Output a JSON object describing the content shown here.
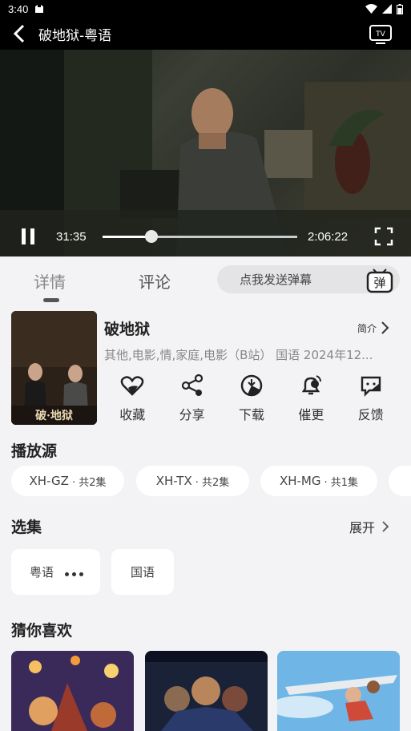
{
  "status_bar": {
    "time": "3:40"
  },
  "header": {
    "title": "破地狱-粤语",
    "back_icon": "back-arrow-icon",
    "cast_icon": "tv-cast-icon"
  },
  "player": {
    "current_time": "31:35",
    "total_time": "2:06:22",
    "progress": 0.25,
    "state": "playing"
  },
  "tabs": [
    {
      "label": "详情",
      "active": true
    },
    {
      "label": "评论",
      "active": false
    }
  ],
  "danmu": {
    "placeholder": "点我发送弹幕",
    "badge": "弹"
  },
  "movie": {
    "title": "破地狱",
    "intro_label": "简介",
    "meta": "其他,电影,情,家庭,电影（B站） 国语 2024年12...",
    "poster_text": "破·地狱"
  },
  "actions": [
    {
      "label": "收藏",
      "icon": "heart-icon"
    },
    {
      "label": "分享",
      "icon": "share-icon"
    },
    {
      "label": "下载",
      "icon": "download-icon"
    },
    {
      "label": "催更",
      "icon": "bell-icon"
    },
    {
      "label": "反馈",
      "icon": "feedback-icon"
    }
  ],
  "sources": {
    "title": "播放源",
    "items": [
      {
        "name": "XH-GZ",
        "count": "· 共2集"
      },
      {
        "name": "XH-TX",
        "count": "· 共2集"
      },
      {
        "name": "XH-MG",
        "count": "· 共1集"
      }
    ]
  },
  "episodes": {
    "title": "选集",
    "expand_label": "展开",
    "items": [
      {
        "label": "粤语",
        "playing": true
      },
      {
        "label": "国语",
        "playing": false
      }
    ]
  },
  "recommend": {
    "title": "猜你喜欢"
  },
  "colors": {
    "background": "#f3f3f5",
    "card": "#ffffff",
    "chrome": "#000000"
  }
}
